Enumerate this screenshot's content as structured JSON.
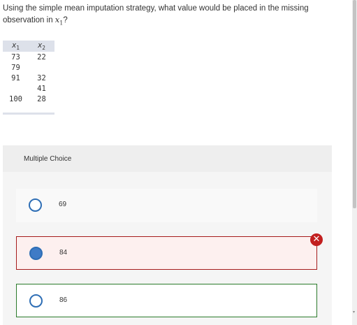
{
  "question": {
    "text_before": "Using the simple mean imputation strategy, what value would be placed in the missing observation in ",
    "var_name": "x",
    "var_sub": "1",
    "text_after": "?"
  },
  "table": {
    "headers": [
      {
        "name": "x",
        "sub": "1"
      },
      {
        "name": "x",
        "sub": "2"
      }
    ],
    "rows": [
      [
        "73",
        "22"
      ],
      [
        "79",
        ""
      ],
      [
        "91",
        "32"
      ],
      [
        "",
        "41"
      ],
      [
        "100",
        "28"
      ]
    ]
  },
  "mc": {
    "label": "Multiple Choice",
    "options": [
      {
        "label": "69",
        "state": "unselected"
      },
      {
        "label": "84",
        "state": "selected-incorrect"
      },
      {
        "label": "86",
        "state": "correct"
      }
    ]
  },
  "feedback_icon": "x-circle-icon"
}
